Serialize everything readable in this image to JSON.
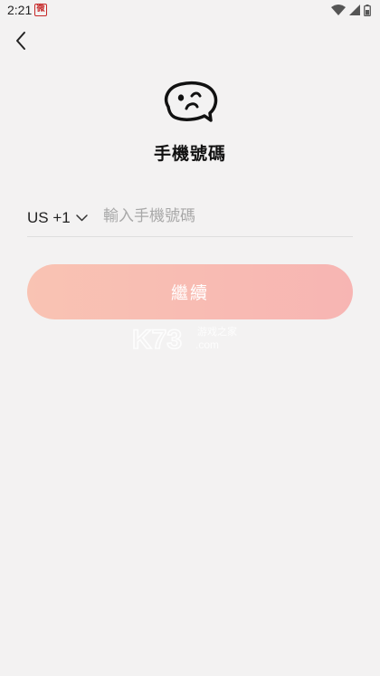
{
  "status_bar": {
    "time": "2:21",
    "notification_glyph": "微"
  },
  "header": {
    "back_icon": "chevron-left-icon"
  },
  "logo": {
    "icon": "smiley-chat-logo-icon"
  },
  "title": "手機號碼",
  "phone_form": {
    "country_code": "US +1",
    "dropdown_icon": "chevron-down-icon",
    "phone_value": "",
    "phone_placeholder": "輸入手機號碼"
  },
  "continue_button": {
    "label": "繼續",
    "gradient_start": "#f9c3b3",
    "gradient_end": "#f7b5b3"
  },
  "watermark": {
    "text": "K73",
    "subtext": "游戏之家",
    "domain": ".com"
  }
}
